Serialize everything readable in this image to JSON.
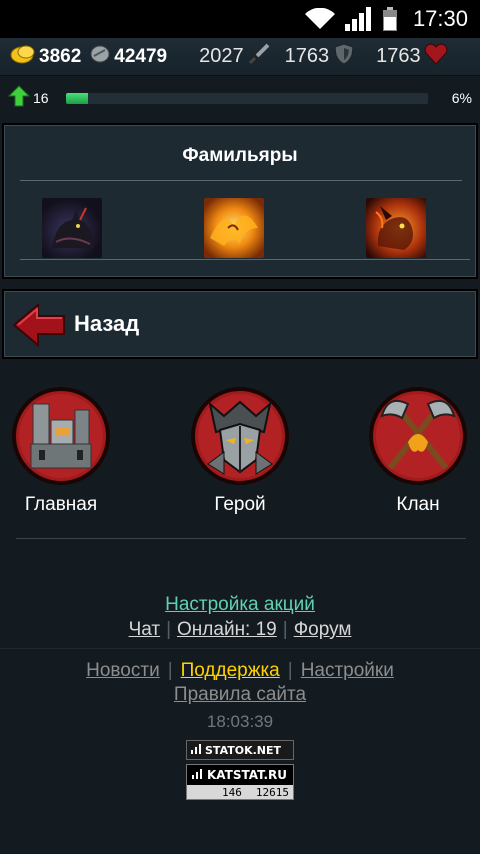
{
  "status_bar": {
    "time": "17:30",
    "icons": [
      "wifi-icon",
      "signal-icon",
      "battery-icon"
    ]
  },
  "resources": {
    "gold": "3862",
    "silver": "42479"
  },
  "stats": {
    "attack": "2027",
    "defense": "1763",
    "health": "1763"
  },
  "level": {
    "value": "16",
    "xp_percent_label": "6%",
    "xp_fraction": 0.06
  },
  "familiars": {
    "title": "Фамильяры",
    "items": [
      "black-cat-familiar",
      "fire-phoenix-familiar",
      "fire-dragon-familiar"
    ]
  },
  "back": {
    "label": "Назад"
  },
  "nav": {
    "items": [
      {
        "label": "Главная",
        "icon": "castle-icon"
      },
      {
        "label": "Герой",
        "icon": "helmet-icon"
      },
      {
        "label": "Клан",
        "icon": "crossed-axes-icon"
      }
    ]
  },
  "links": {
    "promo_settings": "Настройка акций",
    "chat": "Чат",
    "online": "Онлайн: 19",
    "forum": "Форум",
    "news": "Новости",
    "support": "Поддержка",
    "settings": "Настройки",
    "rules": "Правила сайта"
  },
  "server_time": "18:03:39",
  "counters": {
    "statok": "STATOK.NET",
    "katstat": "KATSTAT.RU",
    "value1": "146",
    "value2": "12615"
  },
  "colors": {
    "background": "#131b21",
    "xp": "#2fbf5a",
    "link_teal": "#5fd1b2",
    "link_active": "#ffd200"
  }
}
